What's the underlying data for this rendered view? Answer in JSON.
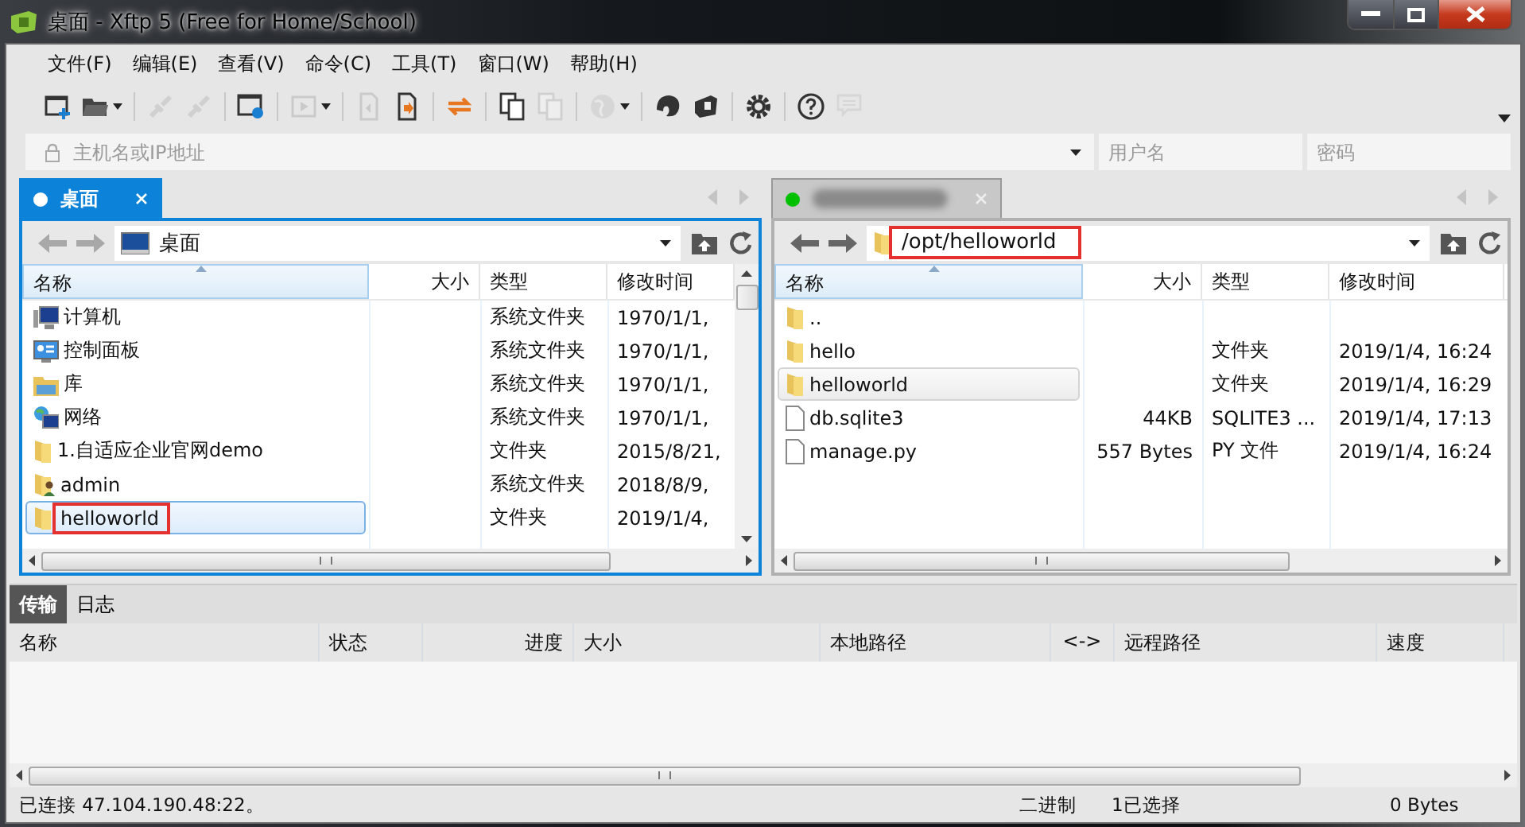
{
  "window": {
    "title": "桌面 - Xftp 5 (Free for Home/School)"
  },
  "menu": [
    "文件(F)",
    "编辑(E)",
    "查看(V)",
    "命令(C)",
    "工具(T)",
    "窗口(W)",
    "帮助(H)"
  ],
  "toolbar": [
    [
      {
        "kind": "new-session",
        "disabled": false,
        "dropdown": false
      },
      {
        "kind": "open-folder",
        "disabled": false,
        "dropdown": true
      }
    ],
    [
      {
        "kind": "connect",
        "disabled": true,
        "dropdown": false
      },
      {
        "kind": "disconnect",
        "disabled": true,
        "dropdown": false
      }
    ],
    [
      {
        "kind": "properties",
        "disabled": false,
        "dropdown": false
      }
    ],
    [
      {
        "kind": "play",
        "disabled": true,
        "dropdown": true
      }
    ],
    [
      {
        "kind": "download",
        "disabled": true,
        "dropdown": false
      },
      {
        "kind": "upload",
        "disabled": false,
        "dropdown": false
      }
    ],
    [
      {
        "kind": "transfer",
        "disabled": false,
        "dropdown": false
      }
    ],
    [
      {
        "kind": "copy",
        "disabled": false,
        "dropdown": false
      },
      {
        "kind": "paste",
        "disabled": true,
        "dropdown": false
      }
    ],
    [
      {
        "kind": "globe",
        "disabled": true,
        "dropdown": true
      }
    ],
    [
      {
        "kind": "shell",
        "disabled": false,
        "dropdown": false
      },
      {
        "kind": "app",
        "disabled": false,
        "dropdown": false
      }
    ],
    [
      {
        "kind": "settings",
        "disabled": false,
        "dropdown": false
      }
    ],
    [
      {
        "kind": "help",
        "disabled": false,
        "dropdown": false
      },
      {
        "kind": "chat",
        "disabled": true,
        "dropdown": false
      }
    ]
  ],
  "address_bar": {
    "host_placeholder": "主机名或IP地址",
    "user_placeholder": "用户名",
    "password_placeholder": "密码"
  },
  "panes": [
    {
      "active": true,
      "vertical_scrollbar": true,
      "tab": {
        "title": "桌面",
        "color": "#ffffff"
      },
      "path": {
        "text": "桌面",
        "kind": "desktop",
        "highlighted": false
      },
      "columns": [
        "名称",
        "大小",
        "类型",
        "修改时间"
      ],
      "rows": [
        {
          "kind": "computer",
          "name": "计算机",
          "size": "",
          "type": "系统文件夹",
          "modified": "1970/1/1,",
          "selected": false,
          "highlighted": false
        },
        {
          "kind": "control-panel",
          "name": "控制面板",
          "size": "",
          "type": "系统文件夹",
          "modified": "1970/1/1,",
          "selected": false,
          "highlighted": false
        },
        {
          "kind": "library",
          "name": "库",
          "size": "",
          "type": "系统文件夹",
          "modified": "1970/1/1,",
          "selected": false,
          "highlighted": false
        },
        {
          "kind": "network",
          "name": "网络",
          "size": "",
          "type": "系统文件夹",
          "modified": "1970/1/1,",
          "selected": false,
          "highlighted": false
        },
        {
          "kind": "folder",
          "name": "1.自适应企业官网demo",
          "size": "",
          "type": "文件夹",
          "modified": "2015/8/21,",
          "selected": false,
          "highlighted": false
        },
        {
          "kind": "user-folder",
          "name": "admin",
          "size": "",
          "type": "系统文件夹",
          "modified": "2018/8/9,",
          "selected": false,
          "highlighted": false
        },
        {
          "kind": "folder",
          "name": "helloworld",
          "size": "",
          "type": "文件夹",
          "modified": "2019/1/4,",
          "selected": true,
          "highlighted": true
        }
      ]
    },
    {
      "active": false,
      "vertical_scrollbar": false,
      "tab": {
        "color": "#00c000"
      },
      "path": {
        "text": "/opt/helloworld",
        "kind": "folder",
        "highlighted": true
      },
      "columns": [
        "名称",
        "大小",
        "类型",
        "修改时间"
      ],
      "rows": [
        {
          "kind": "folder",
          "name": "..",
          "size": "",
          "type": "",
          "modified": "",
          "selected": false,
          "highlighted": false
        },
        {
          "kind": "folder",
          "name": "hello",
          "size": "",
          "type": "文件夹",
          "modified": "2019/1/4, 16:24",
          "selected": false,
          "highlighted": false
        },
        {
          "kind": "folder",
          "name": "helloworld",
          "size": "",
          "type": "文件夹",
          "modified": "2019/1/4, 16:29",
          "selected": true,
          "highlighted": false
        },
        {
          "kind": "file",
          "name": "db.sqlite3",
          "size": "44KB",
          "type": "SQLITE3 ...",
          "modified": "2019/1/4, 17:13",
          "selected": false,
          "highlighted": false
        },
        {
          "kind": "file",
          "name": "manage.py",
          "size": "557 Bytes",
          "type": "PY 文件",
          "modified": "2019/1/4, 16:24",
          "selected": false,
          "highlighted": false
        }
      ]
    }
  ],
  "transfer": {
    "tabs": [
      {
        "label": "传输",
        "selected": true
      },
      {
        "label": "日志",
        "selected": false
      }
    ],
    "columns": [
      "名称",
      "状态",
      "进度",
      "大小",
      "本地路径",
      "<->",
      "远程路径",
      "速度"
    ]
  },
  "status_bar": [
    "已连接 47.104.190.48:22。",
    "二进制",
    "1已选择",
    "0 Bytes"
  ]
}
